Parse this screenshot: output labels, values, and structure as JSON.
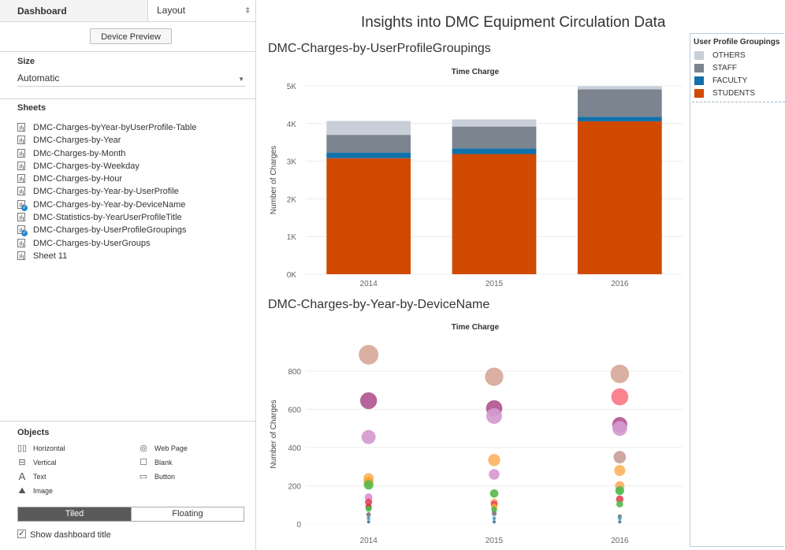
{
  "left_pane": {
    "tab_dashboard": "Dashboard",
    "tab_layout": "Layout",
    "tab_layout_arrow": "⇕",
    "device_preview": "Device Preview",
    "size_title": "Size",
    "size_value": "Automatic",
    "sheets_title": "Sheets",
    "sheets": [
      {
        "label": "DMC-Charges-byYear-byUserProfile-Table",
        "used": false
      },
      {
        "label": "DMC-Charges-by-Year",
        "used": false
      },
      {
        "label": "DMc-Charges-by-Month",
        "used": false
      },
      {
        "label": "DMC-Charges-by-Weekday",
        "used": false
      },
      {
        "label": "DMC-Charges-by-Hour",
        "used": false
      },
      {
        "label": "DMC-Charges-by-Year-by-UserProfile",
        "used": false
      },
      {
        "label": "DMC-Charges-by-Year-by-DeviceName",
        "used": true
      },
      {
        "label": "DMC-Statistics-by-YearUserProfileTitle",
        "used": false
      },
      {
        "label": "DMC-Charges-by-UserProfileGroupings",
        "used": true
      },
      {
        "label": "DMC-Charges-by-UserGroups",
        "used": false
      },
      {
        "label": "Sheet 11",
        "used": false
      }
    ],
    "objects_title": "Objects",
    "objects": {
      "horizontal": "Horizontal",
      "vertical": "Vertical",
      "text": "Text",
      "image": "Image",
      "web_page": "Web Page",
      "blank": "Blank",
      "button": "Button"
    },
    "tiled": "Tiled",
    "floating": "Floating",
    "show_title": "Show dashboard title"
  },
  "dashboard": {
    "title": "Insights into DMC Equipment Circulation Data"
  },
  "legend": {
    "title": "User Profile Groupings",
    "items": [
      {
        "label": "OTHERS",
        "color": "#c8cfd9"
      },
      {
        "label": "STAFF",
        "color": "#7b848f"
      },
      {
        "label": "FACULTY",
        "color": "#1170aa"
      },
      {
        "label": "STUDENTS",
        "color": "#d04a02"
      }
    ]
  },
  "chart_data": [
    {
      "type": "bar",
      "title": "DMC-Charges-by-UserProfileGroupings",
      "subtitle": "Time Charge",
      "ylabel": "Number of Charges",
      "categories": [
        "2014",
        "2015",
        "2016"
      ],
      "ylim": [
        0,
        5000
      ],
      "yticks": [
        0,
        1000,
        2000,
        3000,
        4000,
        5000
      ],
      "ytick_labels": [
        "0K",
        "1K",
        "2K",
        "3K",
        "4K",
        "5K"
      ],
      "stacked": true,
      "series": [
        {
          "name": "STUDENTS",
          "values": [
            3080,
            3190,
            4060
          ],
          "color": "#d04a02"
        },
        {
          "name": "FACULTY",
          "values": [
            150,
            150,
            120
          ],
          "color": "#1170aa"
        },
        {
          "name": "STAFF",
          "values": [
            470,
            580,
            730
          ],
          "color": "#7b848f"
        },
        {
          "name": "OTHERS",
          "values": [
            370,
            190,
            80
          ],
          "color": "#c8cfd9"
        }
      ]
    },
    {
      "type": "scatter",
      "title": "DMC-Charges-by-Year-by-DeviceName",
      "subtitle": "Time Charge",
      "ylabel": "Number of Charges",
      "categories": [
        "2014",
        "2015",
        "2016"
      ],
      "ylim": [
        -20,
        960
      ],
      "yticks": [
        0,
        200,
        400,
        600,
        800
      ],
      "ytick_labels": [
        "0",
        "200",
        "400",
        "600",
        "800"
      ],
      "series": [
        {
          "x": "2014",
          "values": [
            885,
            645,
            455,
            240,
            220,
            205,
            140,
            115,
            90,
            80,
            50,
            30,
            12
          ],
          "colors": [
            "#d7a99a",
            "#b25690",
            "#d59ad0",
            "#fdb462",
            "#f7a334",
            "#59b84e",
            "#de8fd6",
            "#e34a5b",
            "#d33643",
            "#4db84f",
            "#7a7a7a",
            "#4f9cc7",
            "#3b7b8a"
          ]
        },
        {
          "x": "2015",
          "values": [
            770,
            605,
            565,
            335,
            260,
            160,
            115,
            105,
            90,
            75,
            55,
            30,
            12
          ],
          "colors": [
            "#d7a99a",
            "#b25690",
            "#d59ad0",
            "#fdb462",
            "#d59ad0",
            "#59b84e",
            "#fdae61",
            "#e34a5b",
            "#f7a334",
            "#4db84f",
            "#7a7a7a",
            "#4f9cc7",
            "#3b7b8a"
          ]
        },
        {
          "x": "2016",
          "values": [
            785,
            665,
            520,
            500,
            350,
            280,
            200,
            175,
            130,
            105,
            40,
            30,
            12
          ],
          "colors": [
            "#d7a99a",
            "#fa7a84",
            "#b25690",
            "#d59ad0",
            "#c9a199",
            "#fdb462",
            "#fdae61",
            "#4db84f",
            "#e34a5b",
            "#59b84e",
            "#7a7a7a",
            "#4f9cc7",
            "#3b7b8a"
          ]
        }
      ]
    }
  ]
}
